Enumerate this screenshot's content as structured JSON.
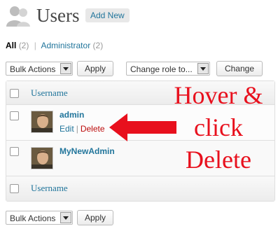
{
  "header": {
    "title": "Users",
    "add_new_label": "Add New",
    "icon": "users-icon"
  },
  "filters": {
    "all_label": "All",
    "all_count": "(2)",
    "admin_label": "Administrator",
    "admin_count": "(2)",
    "separator": "|"
  },
  "top_controls": {
    "bulk_actions": "Bulk Actions",
    "apply_label": "Apply",
    "change_role": "Change role to...",
    "change_label": "Change"
  },
  "table": {
    "column_header": "Username",
    "column_footer": "Username",
    "rows": [
      {
        "username": "admin",
        "edit_label": "Edit",
        "separator": "|",
        "delete_label": "Delete"
      },
      {
        "username": "MyNewAdmin"
      }
    ]
  },
  "bottom_controls": {
    "bulk_actions": "Bulk Actions",
    "apply_label": "Apply"
  },
  "annotation": {
    "line1": "Hover &",
    "line2": "click",
    "line3": "Delete",
    "color": "#e8101d"
  },
  "colors": {
    "link": "#21759b",
    "delete": "#bc0b0b"
  }
}
